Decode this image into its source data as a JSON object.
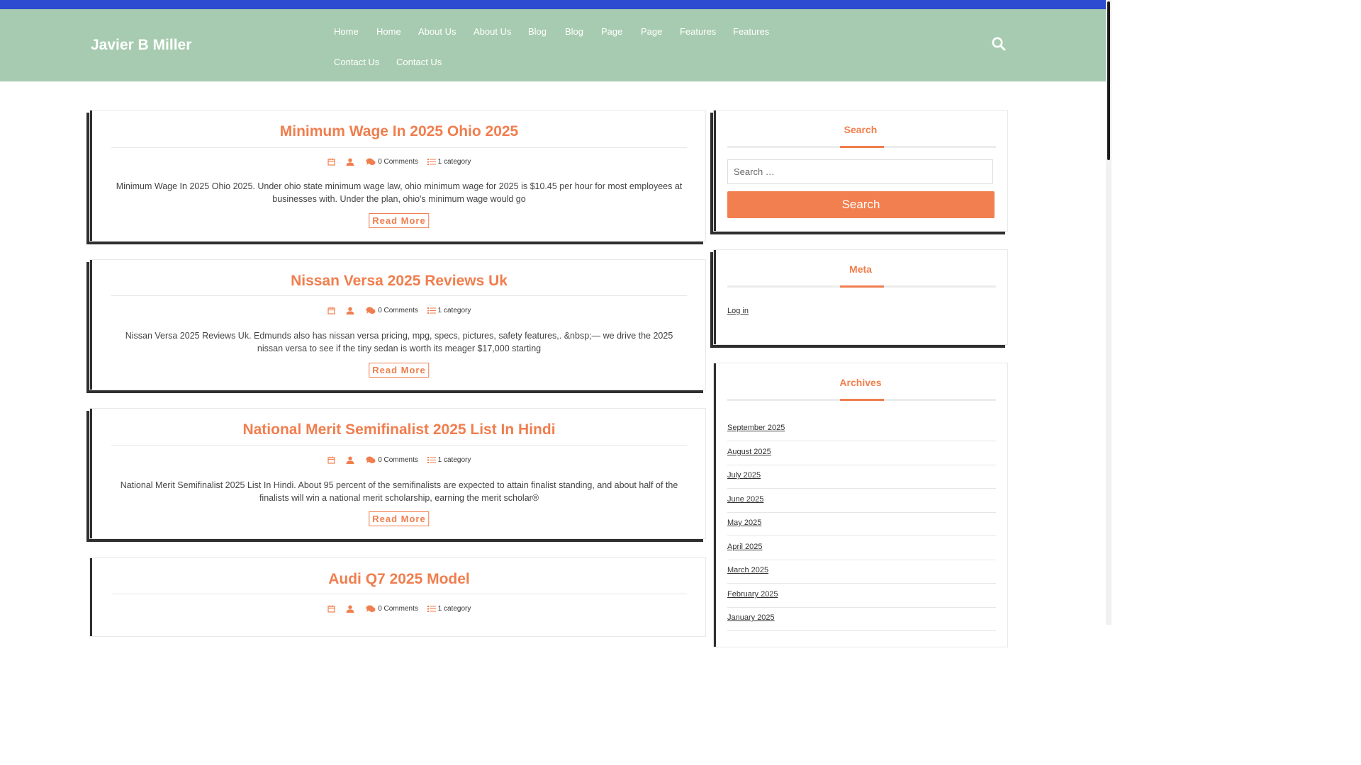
{
  "site": {
    "title": "Javier B Miller"
  },
  "nav": {
    "items": [
      {
        "label": "Home"
      },
      {
        "label": "Home"
      },
      {
        "label": "About Us"
      },
      {
        "label": "About Us"
      },
      {
        "label": "Blog"
      },
      {
        "label": "Blog"
      },
      {
        "label": "Page"
      },
      {
        "label": "Page"
      },
      {
        "label": "Features"
      },
      {
        "label": "Features"
      },
      {
        "label": "Contact Us"
      },
      {
        "label": "Contact Us"
      }
    ]
  },
  "posts": [
    {
      "title": "Minimum Wage In 2025 Ohio 2025",
      "comments": "0 Comments",
      "category": "1 category",
      "excerpt": "Minimum Wage In 2025 Ohio 2025. Under ohio state minimum wage law, ohio minimum wage for 2025 is $10.45 per hour for most employees at businesses with. Under the plan, ohio's minimum wage would go",
      "read_more": "Read More"
    },
    {
      "title": "Nissan Versa 2025 Reviews Uk",
      "comments": "0 Comments",
      "category": "1 category",
      "excerpt": "Nissan Versa 2025 Reviews Uk. Edmunds also has nissan versa pricing, mpg, specs, pictures, safety features,. &nbsp;— we drive the 2025 nissan versa to see if the tiny sedan is worth its meager $17,000 starting",
      "read_more": "Read More"
    },
    {
      "title": "National Merit Semifinalist 2025 List In Hindi",
      "comments": "0 Comments",
      "category": "1 category",
      "excerpt": "National Merit Semifinalist 2025 List In Hindi. About 95 percent of the semifinalists are expected to attain finalist standing, and about half of the finalists will win a national merit scholarship, earning the merit scholar®",
      "read_more": "Read More"
    },
    {
      "title": "Audi Q7 2025 Model",
      "comments": "0 Comments",
      "category": "1 category"
    }
  ],
  "sidebar": {
    "search": {
      "title": "Search",
      "placeholder": "Search …",
      "button": "Search"
    },
    "meta": {
      "title": "Meta",
      "login": "Log in"
    },
    "archives": {
      "title": "Archives",
      "items": [
        "September 2025",
        "August 2025",
        "July 2025",
        "June 2025",
        "May 2025",
        "April 2025",
        "March 2025",
        "February 2025",
        "January 2025"
      ]
    }
  },
  "colors": {
    "accent": "#f07e4e",
    "header_bg": "#a7cbb0",
    "topbar": "#2c4bd1",
    "shadow": "#2f2f2f"
  },
  "icons": {
    "header_search": "search-icon",
    "meta_date": "calendar-icon",
    "meta_author": "user-icon",
    "meta_comments": "comments-icon",
    "meta_category": "list-icon"
  }
}
